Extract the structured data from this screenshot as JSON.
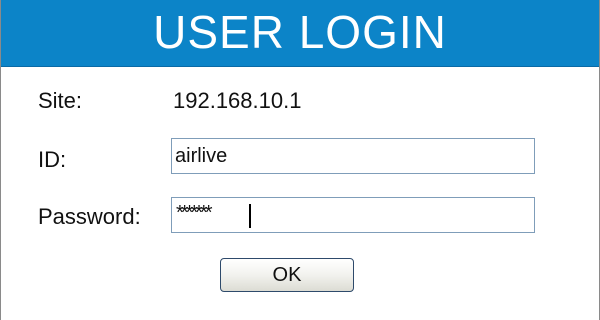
{
  "header": {
    "title": "USER LOGIN"
  },
  "form": {
    "site_label": "Site:",
    "site_value": "192.168.10.1",
    "id_label": "ID:",
    "id_value": "airlive",
    "password_label": "Password:",
    "password_value": "*******",
    "ok_label": "OK"
  },
  "colors": {
    "header_bg": "#0c84c8",
    "header_text": "#ffffff",
    "input_border": "#7f9db9"
  }
}
